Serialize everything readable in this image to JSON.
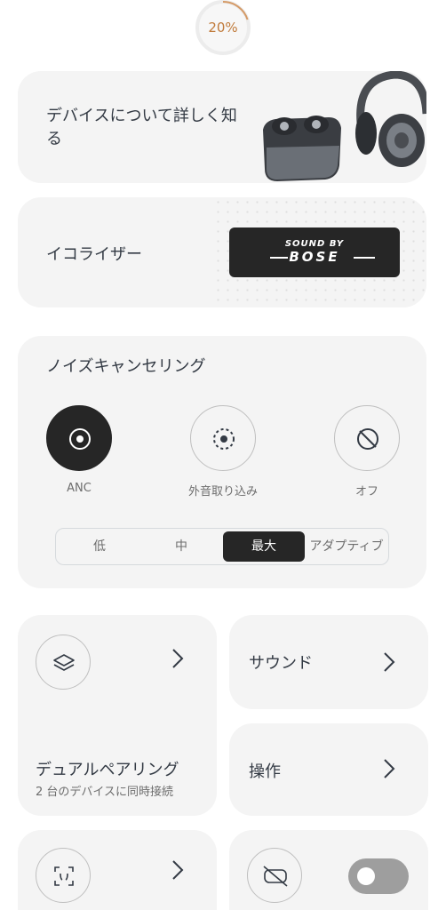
{
  "battery": {
    "percent_label": "20%",
    "level": 0.2,
    "color": "#c07a3a"
  },
  "learn_card": {
    "title": "デバイスについて詳しく知る"
  },
  "equalizer_card": {
    "title": "イコライザー",
    "brand_line1": "SOUND BY",
    "brand_line2": "BOSE"
  },
  "noise_cancelling": {
    "title": "ノイズキャンセリング",
    "modes": [
      {
        "label": "ANC",
        "icon": "anc-icon",
        "active": true
      },
      {
        "label": "外音取り込み",
        "icon": "ambient-icon",
        "active": false
      },
      {
        "label": "オフ",
        "icon": "off-icon",
        "active": false
      }
    ],
    "levels": [
      {
        "label": "低",
        "active": false
      },
      {
        "label": "中",
        "active": false
      },
      {
        "label": "最大",
        "active": true
      },
      {
        "label": "アダプティブ",
        "active": false
      }
    ]
  },
  "tiles": {
    "dual_pairing": {
      "title": "デュアルペアリング",
      "subtitle": "2 台のデバイスに同時接続",
      "icon": "layers-icon"
    },
    "sound": {
      "title": "サウンド"
    },
    "controls": {
      "title": "操作"
    },
    "bottom_left": {
      "icon": "ear-scan-icon"
    },
    "bottom_right": {
      "icon": "disabled-gamepad-icon",
      "toggle_on": false
    }
  },
  "colors": {
    "card_bg": "#f4f4f4",
    "active_dark": "#262626",
    "text": "#333a44",
    "muted": "#6d6d6d"
  }
}
